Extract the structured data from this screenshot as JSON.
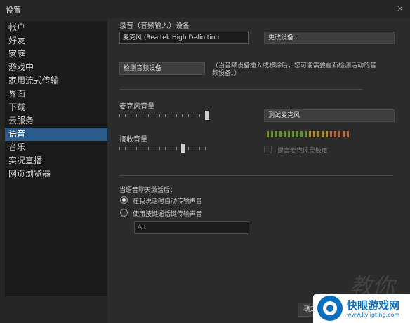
{
  "window": {
    "title": "设置",
    "close_glyph": "×"
  },
  "sidebar": {
    "items": [
      {
        "label": "帐户"
      },
      {
        "label": "好友"
      },
      {
        "label": "家庭"
      },
      {
        "label": "游戏中"
      },
      {
        "label": "家用流式传输"
      },
      {
        "label": "界面"
      },
      {
        "label": "下载"
      },
      {
        "label": "云服务"
      },
      {
        "label": "语音",
        "active": true
      },
      {
        "label": "音乐"
      },
      {
        "label": "实况直播"
      },
      {
        "label": "网页浏览器"
      }
    ]
  },
  "voice": {
    "record_device_label": "录音（音频输入）设备",
    "record_device_value": "麦克风 (Realtek High Definition",
    "change_device_button": "更改设备...",
    "detect_button": "检测音频设备",
    "detect_note": "（当音频设备插入或移除后，您可能需要重新检测活动的音频设备。）",
    "mic_volume_label": "麦克风音量",
    "mic_volume_level": 1.0,
    "receive_volume_label": "接收音量",
    "receive_volume_level": 0.72,
    "test_mic_button": "测试麦克风",
    "boost_checkbox_label": "提高麦克风灵敏度",
    "boost_checked": false,
    "activation_label": "当语音聊天激活后：",
    "radio_auto": "在我说话时自动传输声音",
    "radio_auto_selected": true,
    "radio_ptt": "使用按键通话键传输声音",
    "ptt_key": "Alt",
    "meter_colors": [
      "#6a8f3a",
      "#a78a3a",
      "#b06a4a"
    ]
  },
  "footer": {
    "ok_button": "确定",
    "watermark": "教你识"
  },
  "logo": {
    "name": "快眼游戏网",
    "url": "www.kyligting.com",
    "color": "#0b6fc0"
  },
  "icons": {
    "close": "close-icon",
    "logo": "eye-logo-icon"
  }
}
